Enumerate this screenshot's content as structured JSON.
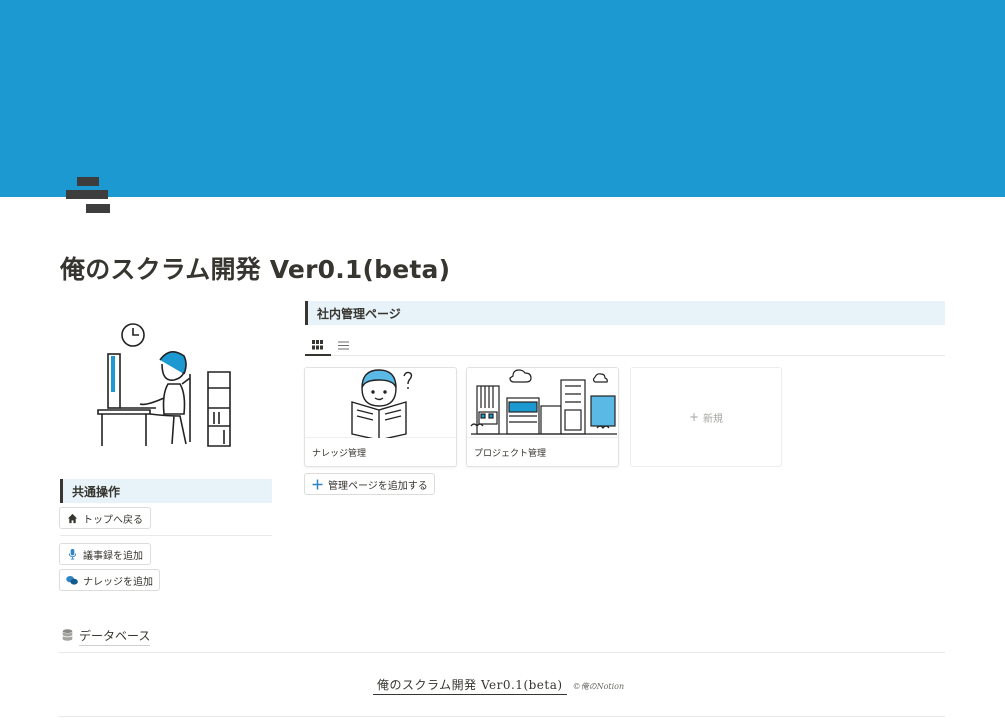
{
  "page": {
    "title": "俺のスクラム開発 Ver0.1(beta)",
    "cover_color": "#1c99d0"
  },
  "common_ops": {
    "header": "共通操作",
    "buttons": [
      {
        "label": "トップへ戻る",
        "icon": "home-icon"
      },
      {
        "label": "議事録を追加",
        "icon": "microphone-icon"
      },
      {
        "label": "ナレッジを追加",
        "icon": "chat-bubbles-icon"
      }
    ]
  },
  "admin": {
    "header": "社内管理ページ",
    "views": [
      {
        "name": "gallery-view",
        "icon": "grid-icon",
        "active": true
      },
      {
        "name": "list-view",
        "icon": "list-icon",
        "active": false
      }
    ],
    "cards": [
      {
        "label": "ナレッジ管理",
        "image": "reading-person-illustration"
      },
      {
        "label": "プロジェクト管理",
        "image": "city-buildings-illustration"
      }
    ],
    "new_label": "新規",
    "add_button": "管理ページを追加する"
  },
  "database_link": {
    "label": "データベース",
    "icon": "database-icon"
  },
  "footer": {
    "main": "俺のスクラム開発 Ver0.1(beta)",
    "small": "©俺のNotion"
  },
  "colors": {
    "accent_blue": "#1c99d0",
    "header_bg": "#e7f3f8",
    "text": "#37352f"
  }
}
